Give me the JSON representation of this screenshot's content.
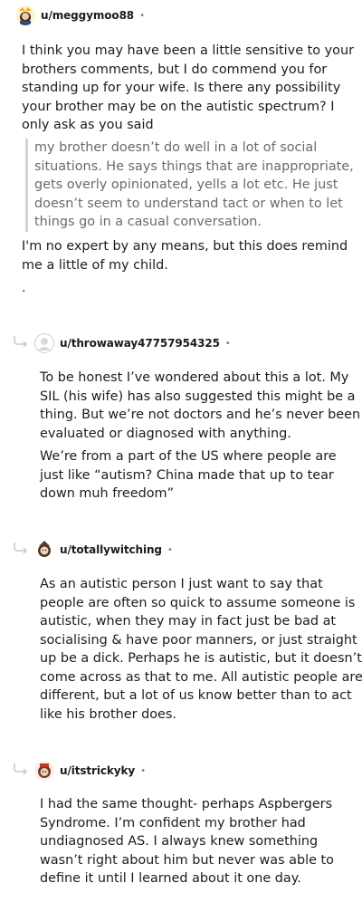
{
  "comments": [
    {
      "username": "u/meggymoo88",
      "separator": "•",
      "avatar": "meggy-avatar",
      "p1": [
        "I think you may have been a little sensitive to your",
        "brothers comments, but I do commend you for",
        "standing up for your wife. Is there any possibility",
        "your brother may be on the autistic spectrum? I",
        "only ask as you said"
      ],
      "quote": [
        "my brother doesn’t do well in a lot of social",
        "situations. He says things that are inappropriate,",
        "gets overly opinionated, yells a lot etc. He just",
        "doesn’t seem to understand tact or when to let",
        "things go in a casual conversation."
      ],
      "p2": [
        "I'm no expert by any means, but this does remind",
        "me a little of my child."
      ],
      "p3": "."
    },
    {
      "username": "u/throwaway47757954325",
      "separator": "•",
      "avatar": "default-avatar",
      "p1": [
        "To be honest I’ve wondered about this a lot. My",
        "SIL (his wife) has also suggested this might be a",
        "thing. But we’re not doctors and he’s never been",
        "evaluated or diagnosed with anything."
      ],
      "p2": [
        "We’re from a part of the US where people are",
        "just like “autism? China made that up to tear",
        "down muh freedom”"
      ]
    },
    {
      "username": "u/totallywitching",
      "separator": "•",
      "avatar": "witch-avatar",
      "p1": [
        "As an autistic person I just want to say that",
        "people are often so quick to assume someone is",
        "autistic, when they may in fact just be bad at",
        "socialising & have poor manners, or just straight",
        "up be a dick. Perhaps he is autistic, but it doesn’t",
        "come across as that to me. All autistic people are",
        "different, but a lot of us know better than to act",
        "like his brother does."
      ]
    },
    {
      "username": "u/itstrickyky",
      "separator": "•",
      "avatar": "tricky-avatar",
      "p1": [
        "I had the same thought- perhaps Aspbergers",
        "Syndrome. I’m confident my brother had",
        "undiagnosed AS. I always knew something",
        "wasn’t right about him but never was able to",
        "define it until I learned about it one day."
      ]
    }
  ],
  "icons": {
    "reply": "reply-arrow-icon"
  }
}
